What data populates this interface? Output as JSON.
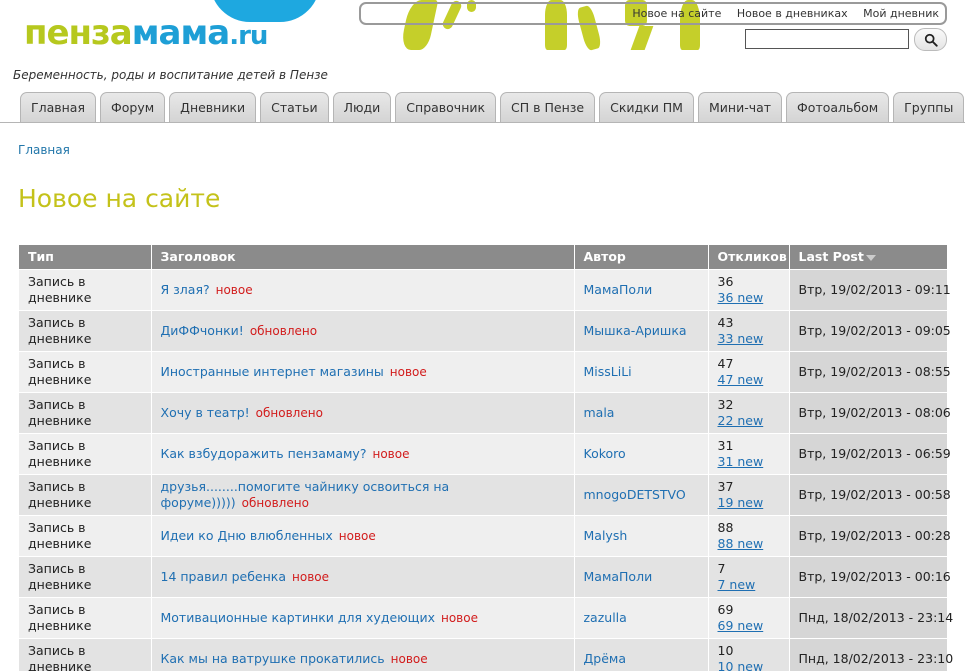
{
  "site": {
    "logo": {
      "part1": "пенза",
      "part2": "мама",
      "part3": ".ru"
    },
    "slogan": "Беременность, роды и воспитание детей в Пензе"
  },
  "top_links": [
    {
      "label": "Новое на сайте"
    },
    {
      "label": "Новое в дневниках"
    },
    {
      "label": "Мой дневник"
    }
  ],
  "search": {
    "value": "",
    "icon": "search-icon"
  },
  "tabs": [
    {
      "label": "Главная"
    },
    {
      "label": "Форум"
    },
    {
      "label": "Дневники"
    },
    {
      "label": "Статьи"
    },
    {
      "label": "Люди"
    },
    {
      "label": "Справочник"
    },
    {
      "label": "СП в Пензе"
    },
    {
      "label": "Скидки ПМ"
    },
    {
      "label": "Мини-чат"
    },
    {
      "label": "Фотоальбом"
    },
    {
      "label": "Группы"
    }
  ],
  "breadcrumb": {
    "home": "Главная"
  },
  "page_title": "Новое на сайте",
  "table": {
    "headers": {
      "type": "Тип",
      "title": "Заголовок",
      "author": "Автор",
      "replies": "Откликов",
      "last_post": "Last Post"
    },
    "rows": [
      {
        "type": "Запись в дневнике",
        "title": "Я злая?",
        "status": "новое",
        "author": "МамаПоли",
        "replies": "36",
        "new": "36 new",
        "last_post": "Втр, 19/02/2013 - 09:11"
      },
      {
        "type": "Запись в дневнике",
        "title": "ДиФФчонки!",
        "status": "обновлено",
        "author": "Мышка-Аришка",
        "replies": "43",
        "new": "33 new",
        "last_post": "Втр, 19/02/2013 - 09:05"
      },
      {
        "type": "Запись в дневнике",
        "title": "Иностранные интернет магазины",
        "status": "новое",
        "author": "MissLiLi",
        "replies": "47",
        "new": "47 new",
        "last_post": "Втр, 19/02/2013 - 08:55"
      },
      {
        "type": "Запись в дневнике",
        "title": "Хочу в театр!",
        "status": "обновлено",
        "author": "mala",
        "replies": "32",
        "new": "22 new",
        "last_post": "Втр, 19/02/2013 - 08:06"
      },
      {
        "type": "Запись в дневнике",
        "title": "Как взбудоражить пензамаму?",
        "status": "новое",
        "author": "Kokoro",
        "replies": "31",
        "new": "31 new",
        "last_post": "Втр, 19/02/2013 - 06:59"
      },
      {
        "type": "Запись в дневнике",
        "title": "друзья........помогите чайнику освоиться на форуме)))))",
        "status": "обновлено",
        "author": "mnogoDETSTVO",
        "replies": "37",
        "new": "19 new",
        "last_post": "Втр, 19/02/2013 - 00:58"
      },
      {
        "type": "Запись в дневнике",
        "title": "Идеи ко Дню влюбленных",
        "status": "новое",
        "author": "Malysh",
        "replies": "88",
        "new": "88 new",
        "last_post": "Втр, 19/02/2013 - 00:28"
      },
      {
        "type": "Запись в дневнике",
        "title": "14 правил ребенка",
        "status": "новое",
        "author": "МамаПоли",
        "replies": "7",
        "new": "7 new",
        "last_post": "Втр, 19/02/2013 - 00:16"
      },
      {
        "type": "Запись в дневнике",
        "title": "Мотивационные картинки для худеющих",
        "status": "новое",
        "author": "zazulla",
        "replies": "69",
        "new": "69 new",
        "last_post": "Пнд, 18/02/2013 - 23:14"
      },
      {
        "type": "Запись в дневнике",
        "title": "Как мы на ватрушке прокатились",
        "status": "новое",
        "author": "Дрёма",
        "replies": "10",
        "new": "10 new",
        "last_post": "Пнд, 18/02/2013 - 23:10"
      }
    ]
  },
  "colors": {
    "accent_green": "#b6c81e",
    "accent_blue": "#1e9fd6",
    "title_yellow": "#c4c21a",
    "link_blue": "#1f6fb2",
    "status_red": "#d21c1c",
    "header_gray": "#8b8b8b"
  }
}
